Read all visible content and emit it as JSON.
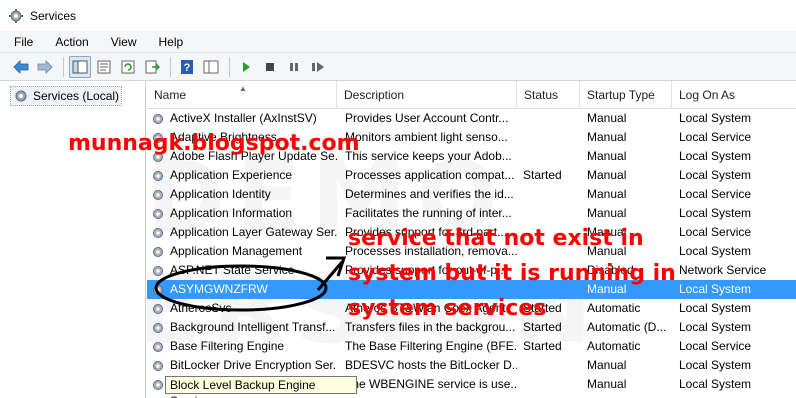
{
  "window": {
    "title": "Services"
  },
  "menu": [
    "File",
    "Action",
    "View",
    "Help"
  ],
  "toolbar_icons": [
    "back-icon",
    "forward-icon",
    "show-tree-icon",
    "properties-icon",
    "refresh-icon",
    "export-list-icon",
    "help-icon",
    "extended-view-icon",
    "start-service-icon",
    "stop-service-icon",
    "pause-service-icon",
    "restart-service-icon"
  ],
  "tree": {
    "root_label": "Services (Local)"
  },
  "columns": {
    "name": "Name",
    "description": "Description",
    "status": "Status",
    "startup": "Startup Type",
    "logon": "Log On As"
  },
  "services": [
    {
      "name": "ActiveX Installer (AxInstSV)",
      "description": "Provides User Account Contr...",
      "status": "",
      "startup": "Manual",
      "logon": "Local System"
    },
    {
      "name": "Adaptive Brightness",
      "description": "Monitors ambient light senso...",
      "status": "",
      "startup": "Manual",
      "logon": "Local Service"
    },
    {
      "name": "Adobe Flash Player Update Se...",
      "description": "This service keeps your Adob...",
      "status": "",
      "startup": "Manual",
      "logon": "Local System"
    },
    {
      "name": "Application Experience",
      "description": "Processes application compat...",
      "status": "Started",
      "startup": "Manual",
      "logon": "Local System"
    },
    {
      "name": "Application Identity",
      "description": "Determines and verifies the id...",
      "status": "",
      "startup": "Manual",
      "logon": "Local Service"
    },
    {
      "name": "Application Information",
      "description": "Facilitates the running of inter...",
      "status": "",
      "startup": "Manual",
      "logon": "Local System"
    },
    {
      "name": "Application Layer Gateway Ser...",
      "description": "Provides support for 3rd part...",
      "status": "",
      "startup": "Manual",
      "logon": "Local Service"
    },
    {
      "name": "Application Management",
      "description": "Processes installation, remova...",
      "status": "",
      "startup": "Manual",
      "logon": "Local System"
    },
    {
      "name": "ASP.NET State Service",
      "description": "Provides support for out-of-p...",
      "status": "",
      "startup": "Disabled",
      "logon": "Network Service"
    },
    {
      "name": "ASYMGWNZFRW",
      "description": "",
      "status": "",
      "startup": "Manual",
      "logon": "Local System",
      "selected": true
    },
    {
      "name": "AtherosSvc",
      "description": "Atheros BT&Wlan Coex Agent",
      "status": "Started",
      "startup": "Automatic",
      "logon": "Local System"
    },
    {
      "name": "Background Intelligent Transf...",
      "description": "Transfers files in the backgrou...",
      "status": "Started",
      "startup": "Automatic (D...",
      "logon": "Local System"
    },
    {
      "name": "Base Filtering Engine",
      "description": "The Base Filtering Engine (BFE...",
      "status": "Started",
      "startup": "Automatic",
      "logon": "Local Service"
    },
    {
      "name": "BitLocker Drive Encryption Ser...",
      "description": "BDESVC hosts the BitLocker D...",
      "status": "",
      "startup": "Manual",
      "logon": "Local System"
    },
    {
      "name": "Block Level Backup Engine Service",
      "description": "The WBENGINE service is use...",
      "status": "",
      "startup": "Manual",
      "logon": "Local System"
    }
  ],
  "tooltip": "Block Level Backup Engine Service",
  "watermark": "DEMO VERSION",
  "overlay": {
    "url_text": "munnagk.blogspot.com",
    "note_text": "service that not exist in system but it is running in system services"
  },
  "colors": {
    "selection": "#3399ff",
    "annotation": "#ff0000",
    "tooltip_bg": "#ffffe1"
  }
}
